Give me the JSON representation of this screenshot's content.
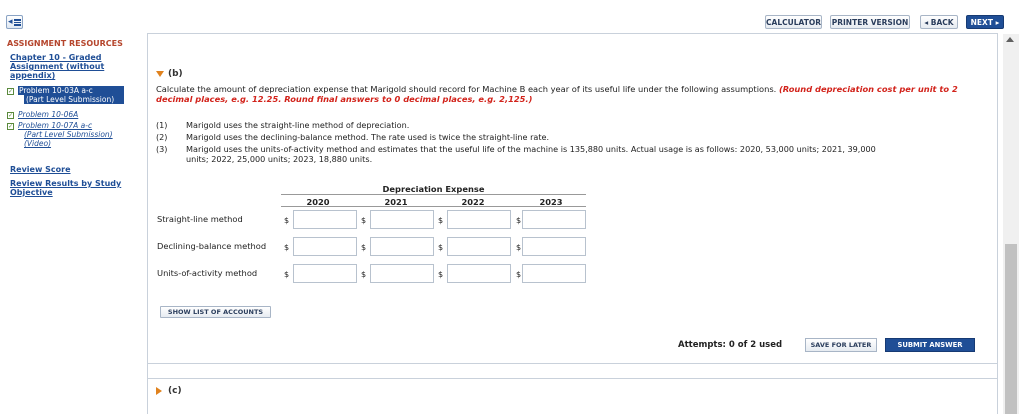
{
  "toolbar": {
    "calculator": "CALCULATOR",
    "printer_version": "PRINTER VERSION",
    "back": "◂ BACK",
    "next": "NEXT ▸"
  },
  "sidebar": {
    "title": "ASSIGNMENT RESOURCES",
    "chapter": "Chapter 10 - Graded Assignment (without appendix)",
    "items": [
      {
        "line1": "Problem 10-03A a-c",
        "line2": "(Part Level Submission)",
        "active": true
      },
      {
        "line1": "Problem 10-06A",
        "line2": ""
      },
      {
        "line1": "Problem 10-07A a-c",
        "line2": "(Part Level Submission)",
        "line3": "(Video)"
      }
    ],
    "review_score": "Review Score",
    "review_results": "Review Results by Study Objective"
  },
  "part_b": {
    "label": "(b)",
    "instruction": "Calculate the amount of depreciation expense that Marigold should record for Machine B each year of its useful life under the following assumptions.",
    "instruction_red": "(Round depreciation cost per unit to 2 decimal places, e.g. 12.25. Round final answers to 0 decimal places, e.g. 2,125.)",
    "assumptions": [
      {
        "num": "(1)",
        "text": "Marigold uses the straight-line method of depreciation."
      },
      {
        "num": "(2)",
        "text": "Marigold uses the declining-balance method. The rate used is twice the straight-line rate."
      },
      {
        "num": "(3)",
        "text": "Marigold uses the units-of-activity method and estimates that the useful life of the machine is 135,880 units. Actual usage is as follows: 2020, 53,000 units; 2021, 39,000",
        "text2": "units; 2022, 25,000 units; 2023, 18,880 units."
      }
    ]
  },
  "table": {
    "title": "Depreciation Expense",
    "years": [
      "2020",
      "2021",
      "2022",
      "2023"
    ],
    "rows": [
      "Straight-line method",
      "Declining-balance method",
      "Units-of-activity method"
    ],
    "currency": "$"
  },
  "actions": {
    "show_accounts": "SHOW LIST OF ACCOUNTS",
    "attempts": "Attempts: 0 of 2 used",
    "save_later": "SAVE FOR LATER",
    "submit": "SUBMIT ANSWER"
  },
  "part_c": {
    "label": "(c)"
  }
}
